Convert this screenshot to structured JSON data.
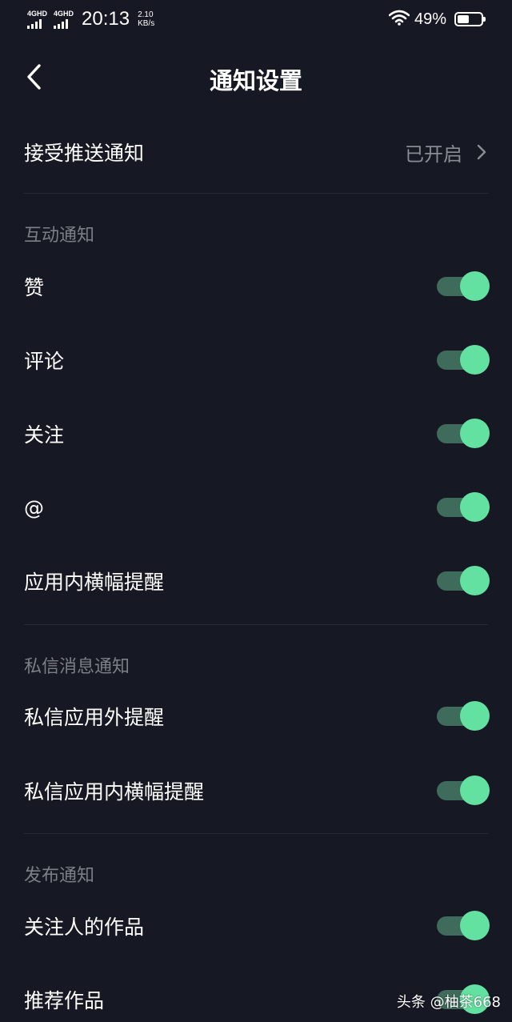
{
  "status_bar": {
    "sim1_label": "4GHD",
    "sim2_label": "4GHD",
    "time": "20:13",
    "speed_value": "2.10",
    "speed_unit": "KB/s",
    "battery_percent": "49%",
    "battery_level": 0.49
  },
  "nav": {
    "title": "通知设置"
  },
  "push": {
    "label": "接受推送通知",
    "value": "已开启"
  },
  "sections": {
    "interaction": {
      "header": "互动通知",
      "items": [
        {
          "label": "赞",
          "on": true
        },
        {
          "label": "评论",
          "on": true
        },
        {
          "label": "关注",
          "on": true
        },
        {
          "label": "@",
          "on": true
        },
        {
          "label": "应用内横幅提醒",
          "on": true
        }
      ]
    },
    "message": {
      "header": "私信消息通知",
      "items": [
        {
          "label": "私信应用外提醒",
          "on": true
        },
        {
          "label": "私信应用内横幅提醒",
          "on": true
        }
      ]
    },
    "publish": {
      "header": "发布通知",
      "items": [
        {
          "label": "关注人的作品",
          "on": true
        },
        {
          "label": "推荐作品",
          "on": true
        }
      ]
    }
  },
  "watermark": "头条 @柚茶668",
  "colors": {
    "background": "#161823",
    "toggle_on_knob": "#63e1a0",
    "toggle_on_track": "#3e6b5b",
    "section_header": "#7d7f86",
    "secondary_text": "#8a8c93"
  }
}
